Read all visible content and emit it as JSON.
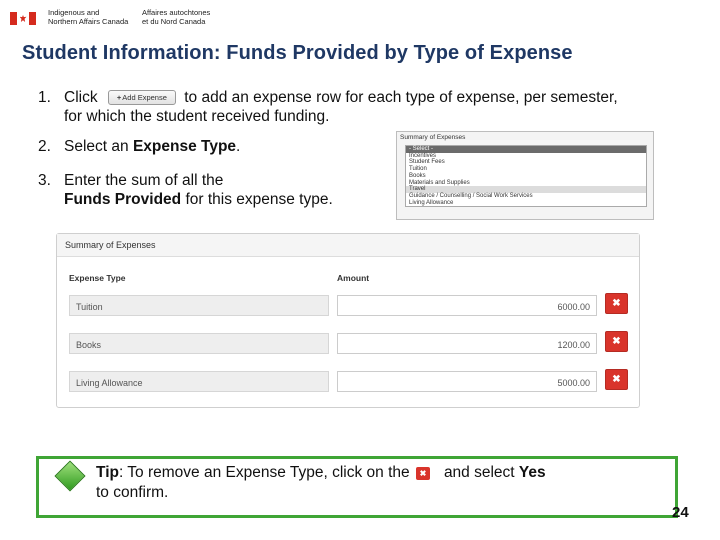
{
  "header": {
    "dept_en_line1": "Indigenous and",
    "dept_en_line2": "Northern Affairs Canada",
    "dept_fr_line1": "Affaires autochtones",
    "dept_fr_line2": "et du Nord Canada"
  },
  "title": "Student Information: Funds Provided by Type of Expense",
  "steps": {
    "step1": {
      "num": "1.",
      "text_before": "Click",
      "button_label": "Add Expense",
      "text_after": "to add an expense row for each type of expense, per semester, for which the student received funding."
    },
    "step2": {
      "num": "2.",
      "text_before": "Select an",
      "emphasis": "Expense Type",
      "text_after": "."
    },
    "step3": {
      "num": "3.",
      "text_before": "Enter the sum of all the",
      "emphasis": "Funds Provided",
      "text_after": "for this expense type."
    }
  },
  "dropdown_thumb": {
    "title": "Summary of Expenses",
    "options": [
      "- Select -",
      "Incentives",
      "Student Fees",
      "Tuition",
      "Books",
      "Materials and Supplies",
      "Travel",
      "Guidance / Counselling / Social Work Services",
      "Living Allowance"
    ]
  },
  "summary": {
    "title": "Summary of Expenses",
    "col_type": "Expense Type",
    "col_amount": "Amount",
    "rows": [
      {
        "type": "Tuition",
        "amount": "6000.00",
        "delete": "✖"
      },
      {
        "type": "Books",
        "amount": "1200.00",
        "delete": "✖"
      },
      {
        "type": "Living Allowance",
        "amount": "5000.00",
        "delete": "✖"
      }
    ]
  },
  "tip": {
    "label": "Tip",
    "text_before": ": To remove an Expense Type, click on the",
    "icon": "✖",
    "text_middle": "and select",
    "emphasis": "Yes",
    "text_after": "to confirm."
  },
  "page_number": "24",
  "colors": {
    "title": "#1f3864",
    "delete_button": "#d9342b",
    "tip_border": "#3fa535",
    "flag_red": "#d52b1e"
  }
}
